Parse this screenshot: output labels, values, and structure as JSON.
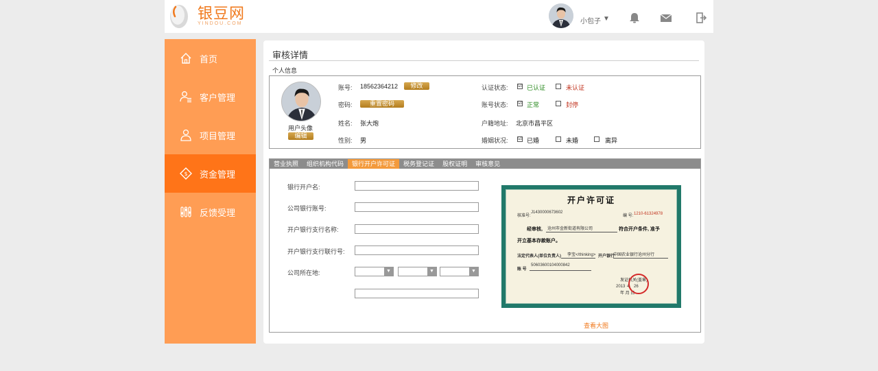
{
  "header": {
    "logo_cn": "银豆网",
    "logo_en": "YINDOU.COM",
    "user_name": "小包子",
    "user_caret": "▼",
    "icons": [
      "bell-icon",
      "mail-icon",
      "logout-icon"
    ]
  },
  "sidebar": {
    "items": [
      {
        "label": "首页",
        "icon": "home-icon",
        "active": false
      },
      {
        "label": "客户管理",
        "icon": "customer-icon",
        "active": false
      },
      {
        "label": "项目管理",
        "icon": "project-icon",
        "active": false
      },
      {
        "label": "资金管理",
        "icon": "money-icon",
        "active": true
      },
      {
        "label": "反馈受理",
        "icon": "feedback-icon",
        "active": false
      }
    ]
  },
  "main": {
    "title": "审核详情",
    "personal": {
      "section_label": "个人信息",
      "avatar_label": "用户头像",
      "edit_label": "编辑",
      "account_label": "账号:",
      "account_value": "18562364212",
      "modify_label": "修改",
      "password_label": "密码:",
      "reset_label": "重置密码",
      "name_label": "姓名:",
      "name_value": "张大炮",
      "gender_label": "性别:",
      "gender_value": "男",
      "auth_label": "认证状态:",
      "auth_yes": "已认证",
      "auth_no": "未认证",
      "acct_status_label": "账号状态:",
      "status_normal": "正常",
      "status_frozen": "封停",
      "address_label": "户籍地址:",
      "address_value": "北京市昌平区",
      "marital_label": "婚姻状况:",
      "married": "已婚",
      "unmarried": "未婚",
      "divorced": "离异",
      "check_mark": "☑"
    },
    "tabs": [
      "营业执照",
      "组织机构代码",
      "银行开户许可证",
      "税务登记证",
      "股权证明",
      "审核意见"
    ],
    "active_tab": "银行开户许可证",
    "form": {
      "bank_account_name": "银行开户名:",
      "company_account": "公司银行账号:",
      "branch_name": "开户银行支行名称:",
      "branch_number": "开户银行支行联行号:",
      "company_location": "公司所在地:",
      "select_arrow": "▼"
    },
    "certificate": {
      "title": "开户许可证",
      "approval_label": "核准号:",
      "approval_no": "J1430000673602",
      "serial_label": "编 号:",
      "serial_no": "1210-61324978",
      "review_label": "经审核,",
      "company": "沧州市金新街道有限公司",
      "conforms": "符合开户条件, 准予",
      "open_basic": "开立基本存款账户。",
      "legal_rep_label": "法定代表人(单位负责人)",
      "legal_rep": "李宝</thinking>",
      "bank_label": "开户银行",
      "bank_value": "中国农业银行沧州分行",
      "account_label": "账 号",
      "account_no": "50603600104000842",
      "issuer_label": "发证机关(盖章)",
      "issue_year": "2013",
      "issue_month": "4",
      "issue_day": "26",
      "issue_units": "年 月 日"
    },
    "view_large": "查看大图"
  },
  "colors": {
    "brand_orange": "#f07a1e",
    "sidebar": "#ff9d54",
    "sidebar_active": "#ff7418",
    "tab_active": "#f39a3c",
    "tab_bg": "#8c8c8c",
    "green": "#2a8a1f",
    "red": "#c0311c"
  }
}
